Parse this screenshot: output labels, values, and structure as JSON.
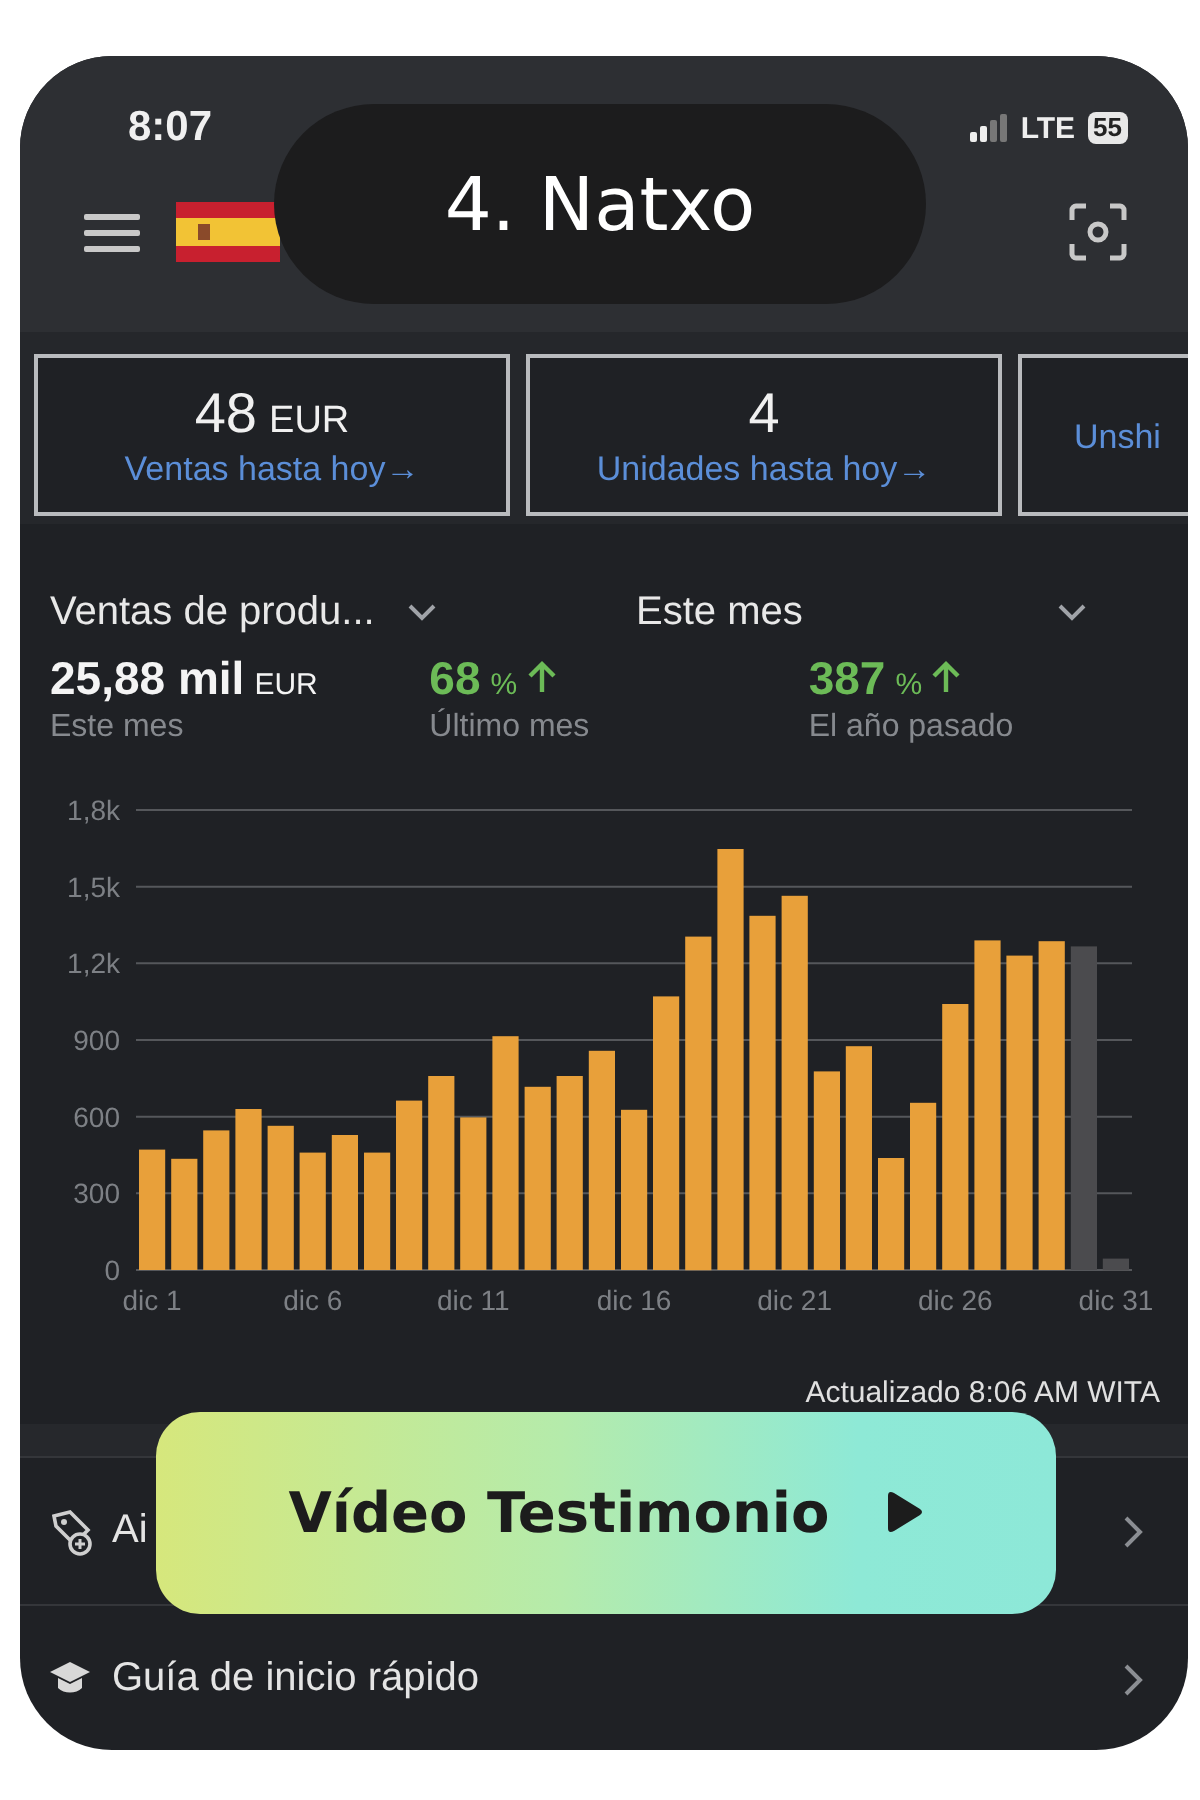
{
  "overlay_title": "4. Natxo",
  "status_bar": {
    "time": "8:07",
    "network": "LTE",
    "battery": "55"
  },
  "cards": [
    {
      "value": "48",
      "unit": "EUR",
      "link": "Ventas hasta hoy→"
    },
    {
      "value": "4",
      "link": "Unidades hasta hoy→"
    },
    {
      "link": "Unshi"
    }
  ],
  "filters": [
    {
      "label": "Ventas de produ..."
    },
    {
      "label": "Este mes"
    }
  ],
  "stats": [
    {
      "value": "25,88 mil",
      "unit": "EUR",
      "caption": "Este mes",
      "kind": "total"
    },
    {
      "value": "68",
      "unit": "%",
      "caption": "Último mes",
      "kind": "change"
    },
    {
      "value": "387",
      "unit": "%",
      "caption": "El año pasado",
      "kind": "change"
    }
  ],
  "chart_data": {
    "type": "bar",
    "stacked": true,
    "categories": [
      "dic 1",
      null,
      null,
      null,
      null,
      "dic 6",
      null,
      null,
      null,
      null,
      "dic 11",
      null,
      null,
      null,
      null,
      "dic 16",
      null,
      null,
      null,
      null,
      "dic 21",
      null,
      null,
      null,
      null,
      "dic 26",
      null,
      null,
      null,
      null,
      "dic 31"
    ],
    "ylim": [
      0,
      1800
    ],
    "grid": true,
    "yticks": [
      0,
      300,
      600,
      900,
      {
        "value": 1200,
        "label": "1,2k"
      },
      {
        "value": 1500,
        "label": "1,5k"
      },
      {
        "value": 1800,
        "label": "1,8k"
      }
    ],
    "series": [
      {
        "color": "#e8a03a",
        "values": [
          471,
          435,
          546,
          630,
          564,
          459,
          528,
          459,
          663,
          759,
          597,
          915,
          717,
          759,
          858,
          627,
          1071,
          1305,
          1647,
          1386,
          1464,
          777,
          876,
          438,
          654,
          1041,
          1290,
          1230,
          1287,
          null,
          null
        ]
      },
      {
        "color": "#4b4b4e",
        "values": [
          null,
          null,
          null,
          null,
          null,
          null,
          null,
          null,
          null,
          null,
          null,
          null,
          null,
          null,
          null,
          null,
          null,
          null,
          null,
          null,
          null,
          null,
          null,
          null,
          null,
          null,
          null,
          null,
          null,
          1266,
          45
        ]
      }
    ]
  },
  "updated": "Actualizado 8:06 AM WITA",
  "list": [
    {
      "label": "Ai",
      "kind": "tag"
    },
    {
      "label": "Guía de inicio rápido",
      "kind": "guide"
    }
  ],
  "video_button": {
    "label": "Vídeo Testimonio"
  }
}
